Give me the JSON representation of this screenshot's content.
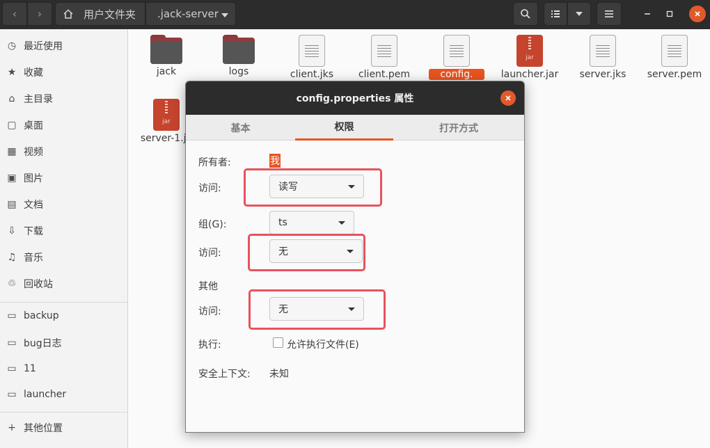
{
  "header": {
    "nav_back": "‹",
    "nav_forward": "›",
    "breadcrumb_home": "用户文件夹",
    "breadcrumb_current": ".jack-server"
  },
  "sidebar": {
    "items": [
      {
        "label": "最近使用",
        "icon": "recent-icon"
      },
      {
        "label": "收藏",
        "icon": "star-icon"
      },
      {
        "label": "主目录",
        "icon": "home-icon"
      },
      {
        "label": "桌面",
        "icon": "desktop-icon"
      },
      {
        "label": "视频",
        "icon": "video-icon"
      },
      {
        "label": "图片",
        "icon": "picture-icon"
      },
      {
        "label": "文档",
        "icon": "document-icon"
      },
      {
        "label": "下载",
        "icon": "download-icon"
      },
      {
        "label": "音乐",
        "icon": "music-icon"
      },
      {
        "label": "回收站",
        "icon": "trash-icon"
      }
    ],
    "bookmarks": [
      "backup",
      "bug日志",
      "11",
      "launcher"
    ],
    "other_locations": "其他位置"
  },
  "files": [
    {
      "name": "jack",
      "type": "folder"
    },
    {
      "name": "logs",
      "type": "folder"
    },
    {
      "name": "client.jks",
      "type": "text"
    },
    {
      "name": "client.pem",
      "type": "text"
    },
    {
      "name": "config.",
      "type": "text",
      "selected": true
    },
    {
      "name": "launcher.jar",
      "type": "jar"
    },
    {
      "name": "server.jks",
      "type": "text"
    },
    {
      "name": "server.pem",
      "type": "text"
    },
    {
      "name": "server-1.ja",
      "type": "jar"
    }
  ],
  "jar_label": "jar",
  "dialog": {
    "title": "config.properties 属性",
    "tabs": [
      "基本",
      "权限",
      "打开方式"
    ],
    "active_tab": "权限",
    "owner_label": "所有者:",
    "owner_value": "我",
    "owner_access_label": "访问:",
    "owner_access_value": "读写",
    "group_label": "组(G):",
    "group_value": "ts",
    "group_access_label": "访问:",
    "group_access_value": "无",
    "others_label": "其他",
    "others_access_label": "访问:",
    "others_access_value": "无",
    "execute_label": "执行:",
    "execute_checkbox_label": "允许执行文件(E)",
    "execute_checked": false,
    "security_label": "安全上下文:",
    "security_value": "未知"
  },
  "colors": {
    "accent": "#e95420",
    "highlight_box": "#e8525c",
    "headerbar": "#2c2c2c"
  }
}
